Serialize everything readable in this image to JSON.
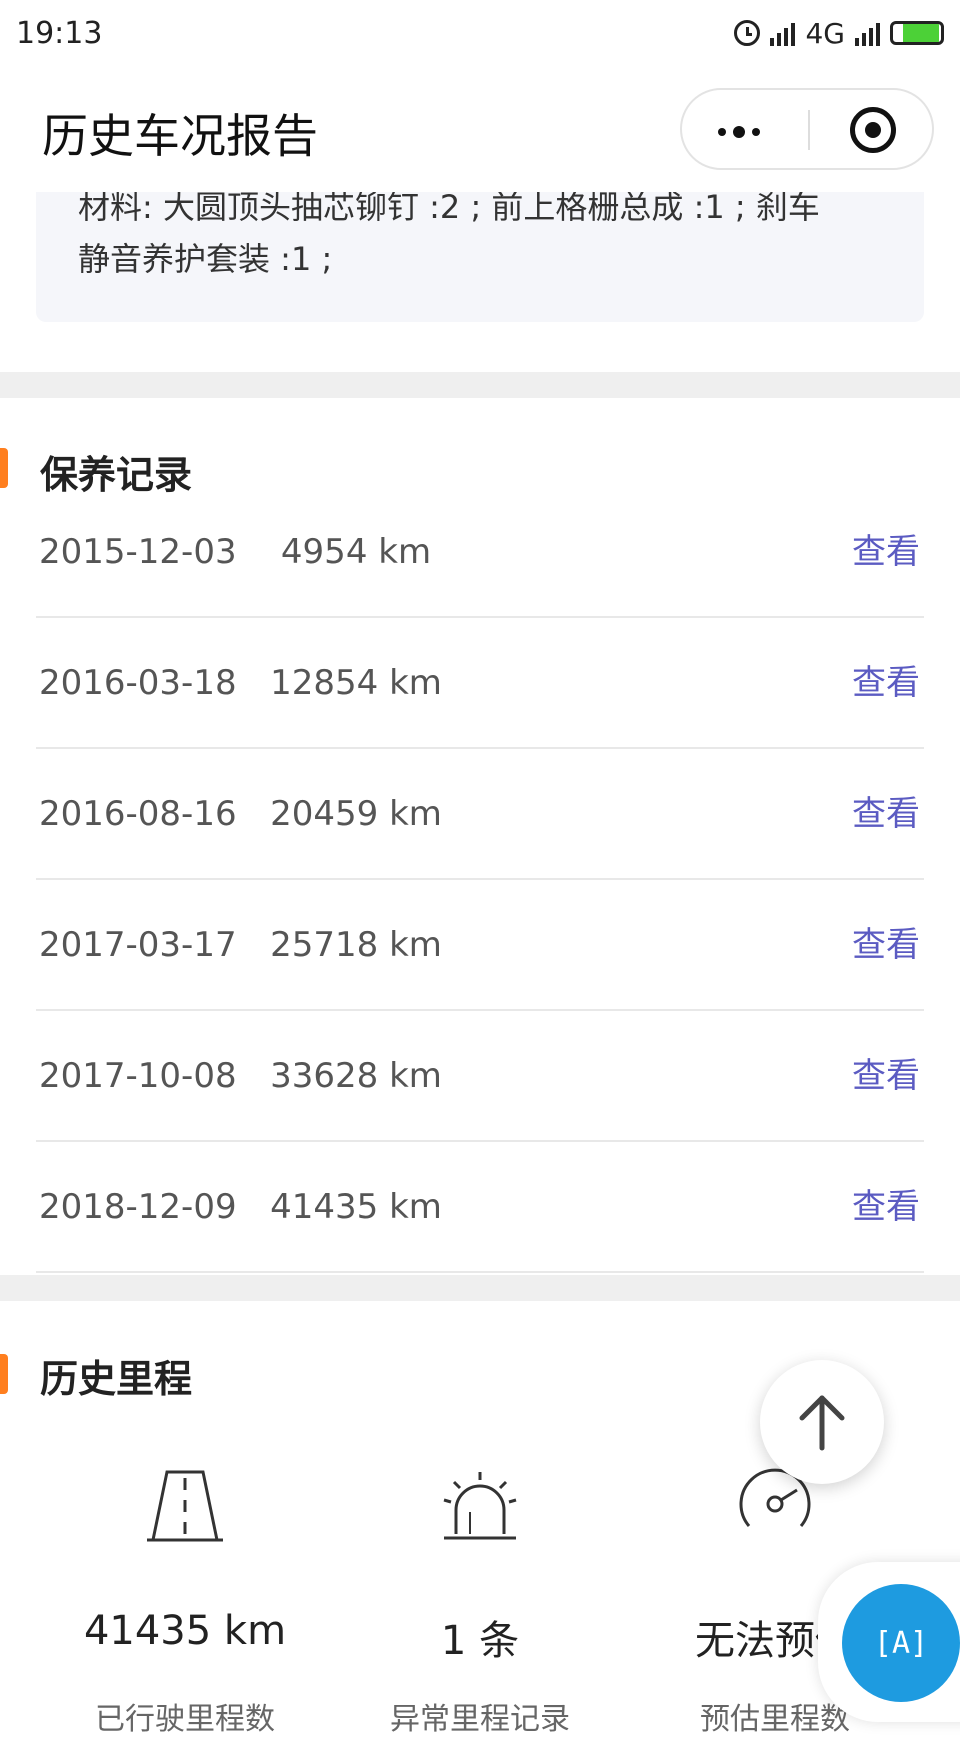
{
  "status_bar": {
    "time": "19:13",
    "network": "4G"
  },
  "nav": {
    "title": "历史车况报告"
  },
  "parts_card": {
    "line1": "材料: 大圆顶头抽芯铆钉 :2 ; 前上格栅总成 :1 ; 刹车",
    "line2": "静音养护套装 :1 ;"
  },
  "maintenance": {
    "title": "保养记录",
    "view_label": "查看",
    "records": [
      {
        "date": "2015-12-03",
        "km": "4954 km"
      },
      {
        "date": "2016-03-18",
        "km": "12854 km"
      },
      {
        "date": "2016-08-16",
        "km": "20459 km"
      },
      {
        "date": "2017-03-17",
        "km": "25718 km"
      },
      {
        "date": "2017-10-08",
        "km": "33628 km"
      },
      {
        "date": "2018-12-09",
        "km": "41435 km"
      }
    ]
  },
  "mileage": {
    "title": "历史里程",
    "stats": [
      {
        "icon": "road-icon",
        "value": "41435 km",
        "label": "已行驶里程数"
      },
      {
        "icon": "alarm-light-icon",
        "value": "1 条",
        "label": "异常里程记录"
      },
      {
        "icon": "gauge-icon",
        "value": "无法预估",
        "label": "预估里程数"
      }
    ]
  },
  "floating": {
    "translate_label": "[A]"
  },
  "colors": {
    "accent": "#ff7f1f",
    "link": "#5b5bc2",
    "translate_button": "#1e9be0"
  }
}
